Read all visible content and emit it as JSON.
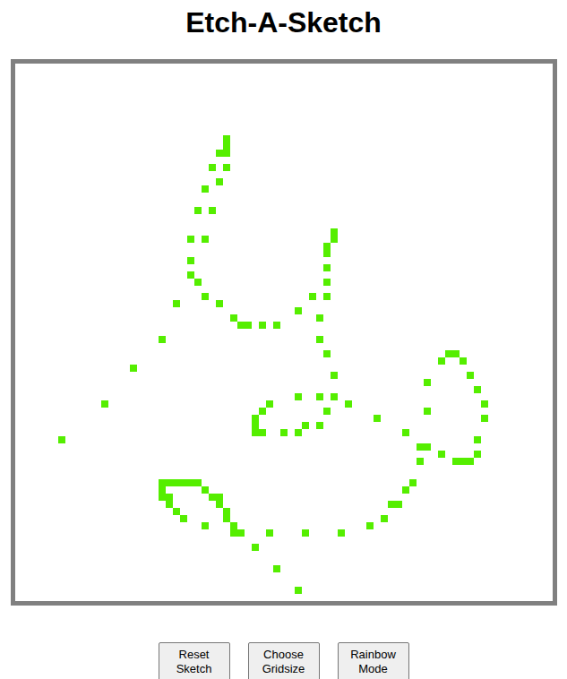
{
  "title": "Etch-A-Sketch",
  "grid": {
    "size": 75,
    "cells": [
      [
        29,
        10
      ],
      [
        29,
        11
      ],
      [
        28,
        12
      ],
      [
        29,
        12
      ],
      [
        27,
        14
      ],
      [
        29,
        14
      ],
      [
        28,
        16
      ],
      [
        26,
        17
      ],
      [
        25,
        20
      ],
      [
        27,
        20
      ],
      [
        24,
        24
      ],
      [
        26,
        24
      ],
      [
        24,
        27
      ],
      [
        24,
        29
      ],
      [
        25,
        30
      ],
      [
        26,
        32
      ],
      [
        22,
        33
      ],
      [
        28,
        33
      ],
      [
        30,
        35
      ],
      [
        31,
        36
      ],
      [
        32,
        36
      ],
      [
        34,
        36
      ],
      [
        36,
        36
      ],
      [
        39,
        34
      ],
      [
        41,
        32
      ],
      [
        43,
        32
      ],
      [
        42,
        35
      ],
      [
        43,
        30
      ],
      [
        43,
        28
      ],
      [
        43,
        26
      ],
      [
        43,
        25
      ],
      [
        44,
        24
      ],
      [
        44,
        23
      ],
      [
        20,
        38
      ],
      [
        16,
        42
      ],
      [
        12,
        47
      ],
      [
        6,
        52
      ],
      [
        42,
        38
      ],
      [
        43,
        40
      ],
      [
        44,
        43
      ],
      [
        39,
        46
      ],
      [
        42,
        46
      ],
      [
        44,
        46
      ],
      [
        46,
        47
      ],
      [
        43,
        48
      ],
      [
        42,
        50
      ],
      [
        40,
        50
      ],
      [
        39,
        51
      ],
      [
        37,
        51
      ],
      [
        35,
        47
      ],
      [
        34,
        48
      ],
      [
        33,
        49
      ],
      [
        33,
        50
      ],
      [
        33,
        51
      ],
      [
        34,
        51
      ],
      [
        50,
        49
      ],
      [
        54,
        51
      ],
      [
        60,
        40
      ],
      [
        61,
        40
      ],
      [
        59,
        41
      ],
      [
        62,
        41
      ],
      [
        63,
        43
      ],
      [
        64,
        45
      ],
      [
        65,
        47
      ],
      [
        65,
        49
      ],
      [
        64,
        52
      ],
      [
        64,
        54
      ],
      [
        61,
        55
      ],
      [
        62,
        55
      ],
      [
        63,
        55
      ],
      [
        59,
        54
      ],
      [
        56,
        53
      ],
      [
        57,
        53
      ],
      [
        56,
        55
      ],
      [
        57,
        48
      ],
      [
        57,
        44
      ],
      [
        55,
        58
      ],
      [
        54,
        59
      ],
      [
        52,
        61
      ],
      [
        53,
        61
      ],
      [
        51,
        63
      ],
      [
        49,
        64
      ],
      [
        45,
        65
      ],
      [
        40,
        65
      ],
      [
        35,
        65
      ],
      [
        33,
        67
      ],
      [
        36,
        70
      ],
      [
        39,
        73
      ],
      [
        20,
        58
      ],
      [
        21,
        58
      ],
      [
        22,
        58
      ],
      [
        23,
        58
      ],
      [
        24,
        58
      ],
      [
        25,
        58
      ],
      [
        20,
        59
      ],
      [
        20,
        60
      ],
      [
        21,
        60
      ],
      [
        21,
        61
      ],
      [
        22,
        62
      ],
      [
        23,
        63
      ],
      [
        26,
        59
      ],
      [
        27,
        60
      ],
      [
        28,
        60
      ],
      [
        28,
        61
      ],
      [
        29,
        62
      ],
      [
        29,
        63
      ],
      [
        26,
        64
      ],
      [
        30,
        64
      ],
      [
        30,
        65
      ],
      [
        31,
        65
      ]
    ]
  },
  "buttons": [
    "Reset Sketch",
    "Choose Gridsize",
    "Rainbow Mode"
  ]
}
